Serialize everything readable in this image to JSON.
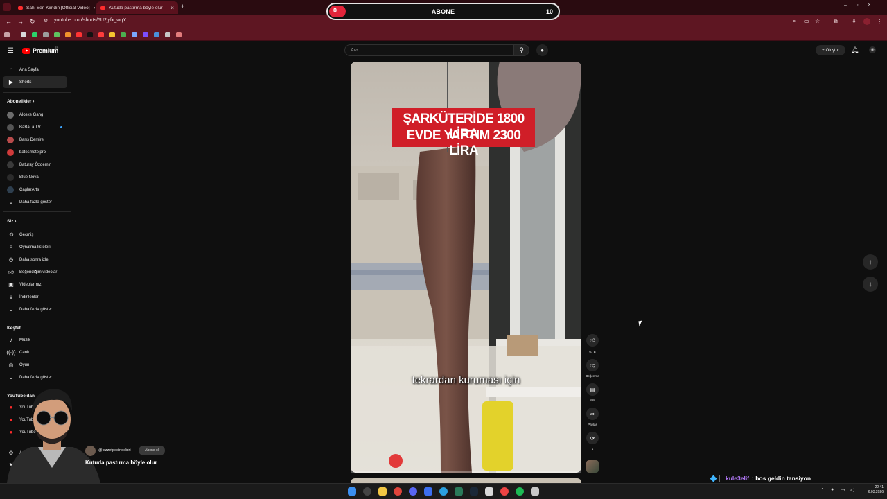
{
  "browser": {
    "tabs": [
      {
        "label": "Sahi Sen Kimdin [Official Video]",
        "active": false
      },
      {
        "label": "Kutuda pastırma böyle olur",
        "active": true
      }
    ],
    "url": "youtube.com/shorts/5U2jyfx_wqY"
  },
  "sub_counter": {
    "current": "0",
    "label": "ABONE",
    "goal": "10",
    "progress_fraction": 0.0
  },
  "header": {
    "logo_text": "Premium",
    "logo_region": "TR",
    "search_placeholder": "Ara",
    "create_label": "Oluştur"
  },
  "sidebar": {
    "main": [
      {
        "label": "Ana Sayfa",
        "icon": "home-icon"
      },
      {
        "label": "Shorts",
        "icon": "shorts-icon",
        "active": true
      }
    ],
    "subscriptions_heading": "Abonelikler",
    "subscriptions": [
      {
        "label": "Aloske Gang",
        "color": "#6d6d6d"
      },
      {
        "label": "BaBaLa TV",
        "color": "#555555"
      },
      {
        "label": "Barış Demirel",
        "color": "#b84b4b"
      },
      {
        "label": "batesmotelpro",
        "color": "#d03a3a"
      },
      {
        "label": "Baturay Özdemir",
        "color": "#3a3a3a"
      },
      {
        "label": "Blue Nova",
        "color": "#2b2b2b"
      },
      {
        "label": "CaglarArts",
        "color": "#2e3f4f"
      }
    ],
    "subs_more": "Daha fazla göster",
    "you_heading": "Siz",
    "you": [
      {
        "label": "Geçmiş",
        "icon": "history-icon"
      },
      {
        "label": "Oynatma listeleri",
        "icon": "playlist-icon"
      },
      {
        "label": "Daha sonra izle",
        "icon": "clock-icon"
      },
      {
        "label": "Beğendiğim videolar",
        "icon": "like-icon"
      },
      {
        "label": "Videolarınız",
        "icon": "video-icon"
      },
      {
        "label": "İndirilenler",
        "icon": "download-icon"
      },
      {
        "label": "Daha fazla göster",
        "icon": "chevron-down-icon"
      }
    ],
    "explore_heading": "Keşfet",
    "explore": [
      {
        "label": "Müzik",
        "icon": "music-icon"
      },
      {
        "label": "Canlı",
        "icon": "live-icon"
      },
      {
        "label": "Oyun",
        "icon": "game-icon"
      },
      {
        "label": "Daha fazla göster",
        "icon": "chevron-down-icon"
      }
    ],
    "more_from_heading": "YouTube'dan",
    "more_from": [
      {
        "label": "YouTube"
      },
      {
        "label": "YouTube"
      },
      {
        "label": "YouTube"
      }
    ],
    "bottom": [
      {
        "label": "Ayarlar",
        "icon": "settings-icon"
      },
      {
        "label": "İç",
        "icon": "flag-icon"
      }
    ]
  },
  "video": {
    "banner_line1": "ŞARKÜTERİDE 1800 LİRA",
    "banner_line2": "EVDE YAPTIM 2300 LİRA",
    "caption": "tekrardan kuruması için",
    "progress_fraction": 0.0
  },
  "actions": {
    "likes": "67 B",
    "dislike": "Beğenme",
    "comments": "868",
    "share": "Paylaş",
    "remix": "1"
  },
  "channel": {
    "handle": "@lezzetpesindebiri",
    "subscribe": "Abone ol",
    "title": "Kutuda pastırma böyle olur"
  },
  "chat": {
    "user": "kule3elif",
    "message": ": hos geldin tansiyon"
  },
  "taskbar": {
    "time": "22:41",
    "date": "6.03.2026"
  }
}
